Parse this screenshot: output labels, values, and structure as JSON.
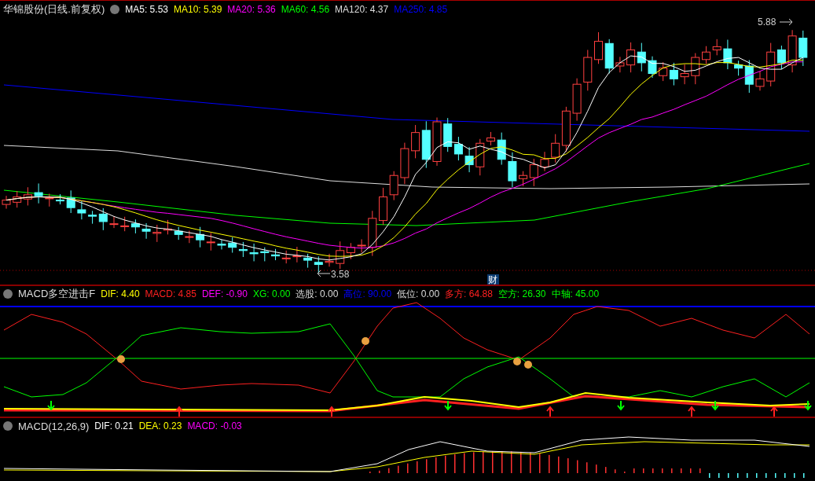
{
  "main_panel": {
    "title": "华锦股份(日线.前复权)",
    "indicators": [
      {
        "label": "MA5: 5.53",
        "color": "#ffffff"
      },
      {
        "label": "MA10: 5.39",
        "color": "#ffff00"
      },
      {
        "label": "MA20: 5.36",
        "color": "#ff00ff"
      },
      {
        "label": "MA60: 4.56",
        "color": "#00ff00"
      },
      {
        "label": "MA120: 4.37",
        "color": "#dddddd"
      },
      {
        "label": "MA250: 4.85",
        "color": "#0000ff"
      }
    ],
    "high_label": "5.88",
    "low_label": "3.58",
    "finance_badge": "财"
  },
  "macd_panel": {
    "title": "MACD多空进击F",
    "indicators": [
      {
        "label": "DIF: 4.40",
        "color": "#ffff00"
      },
      {
        "label": "MACD: 4.85",
        "color": "#ff2020"
      },
      {
        "label": "DEF: -0.90",
        "color": "#ff00ff"
      },
      {
        "label": "XG: 0.00",
        "color": "#00ff00"
      },
      {
        "label": "选股: 0.00",
        "color": "#dddddd"
      },
      {
        "label": "高位: 90.00",
        "color": "#0000ff"
      },
      {
        "label": "低位: 0.00",
        "color": "#dddddd"
      },
      {
        "label": "多方: 64.88",
        "color": "#ff2020"
      },
      {
        "label": "空方: 26.30",
        "color": "#00ff00"
      },
      {
        "label": "中轴: 45.00",
        "color": "#00ff00"
      }
    ]
  },
  "macd_std_panel": {
    "title": "MACD(12,26,9)",
    "indicators": [
      {
        "label": "DIF: 0.21",
        "color": "#ffffff"
      },
      {
        "label": "DEA: 0.23",
        "color": "#ffff00"
      },
      {
        "label": "MACD: -0.03",
        "color": "#ff00ff"
      }
    ]
  }
}
